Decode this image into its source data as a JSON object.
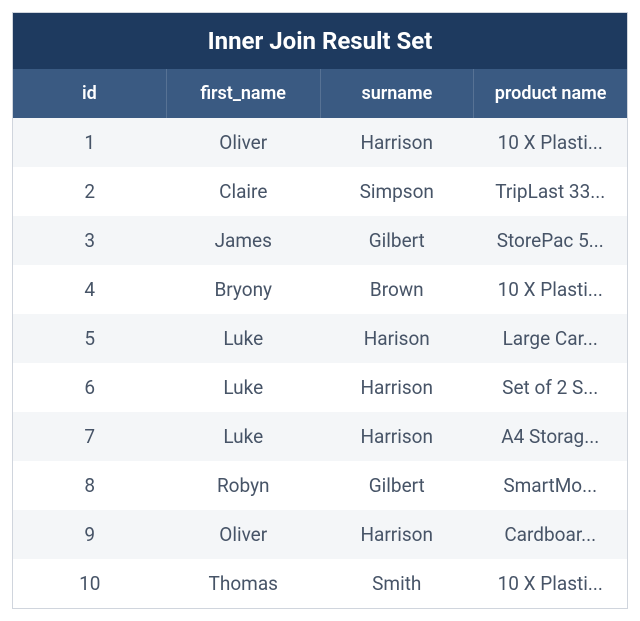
{
  "chart_data": {
    "type": "table",
    "title": "Inner Join Result Set",
    "columns": [
      "id",
      "first_name",
      "surname",
      "product name"
    ],
    "rows": [
      {
        "id": "1",
        "first_name": "Oliver",
        "surname": "Harrison",
        "product_name": "10 X Plasti..."
      },
      {
        "id": "2",
        "first_name": "Claire",
        "surname": "Simpson",
        "product_name": "TripLast 33..."
      },
      {
        "id": "3",
        "first_name": "James",
        "surname": "Gilbert",
        "product_name": "StorePac 5..."
      },
      {
        "id": "4",
        "first_name": "Bryony",
        "surname": "Brown",
        "product_name": "10 X Plasti..."
      },
      {
        "id": "5",
        "first_name": "Luke",
        "surname": "Harison",
        "product_name": "Large Car..."
      },
      {
        "id": "6",
        "first_name": "Luke",
        "surname": "Harrison",
        "product_name": "Set of 2 S..."
      },
      {
        "id": "7",
        "first_name": "Luke",
        "surname": "Harrison",
        "product_name": "A4 Storag..."
      },
      {
        "id": "8",
        "first_name": "Robyn",
        "surname": "Gilbert",
        "product_name": "SmartMo..."
      },
      {
        "id": "9",
        "first_name": "Oliver",
        "surname": "Harrison",
        "product_name": "Cardboar..."
      },
      {
        "id": "10",
        "first_name": "Thomas",
        "surname": "Smith",
        "product_name": "10 X Plasti..."
      }
    ]
  }
}
